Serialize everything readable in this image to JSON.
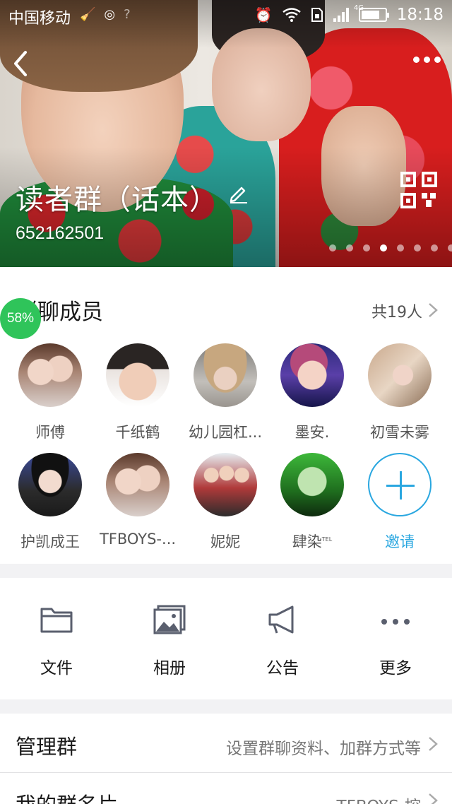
{
  "status_bar": {
    "carrier": "中国移动",
    "network": "4G",
    "time": "18:18",
    "battery_level": 0.8
  },
  "header": {
    "group_name": "读者群（话本）",
    "group_id": "652162501",
    "page_count": 8,
    "active_page": 4
  },
  "members": {
    "title": "群聊成员",
    "count_label": "共19人",
    "progress_badge": "58%",
    "list": [
      {
        "name": "师傅",
        "avatar": "photo-two-girls"
      },
      {
        "name": "千纸鹤",
        "avatar": "photo-boy-cat-ears"
      },
      {
        "name": "幼儿园杠...",
        "avatar": "photo-girl-hat"
      },
      {
        "name": "墨安.",
        "avatar": "photo-boy-stage"
      },
      {
        "name": "初雪未雾",
        "avatar": "photo-girl-street"
      },
      {
        "name": "护凯成王",
        "avatar": "photo-girl-black-cap"
      },
      {
        "name": "TFBOYS-...",
        "avatar": "photo-two-girls"
      },
      {
        "name": "妮妮",
        "avatar": "photo-three-boys"
      },
      {
        "name": "肆染",
        "badge": "TEL",
        "avatar": "photo-girl-green"
      }
    ],
    "invite_label": "邀请"
  },
  "tools": [
    {
      "label": "文件",
      "icon": "folder-icon"
    },
    {
      "label": "相册",
      "icon": "album-icon"
    },
    {
      "label": "公告",
      "icon": "megaphone-icon"
    },
    {
      "label": "更多",
      "icon": "more-dots-icon"
    }
  ],
  "rows": {
    "manage": {
      "title": "管理群",
      "value": "设置群聊资料、加群方式等"
    },
    "card": {
      "title": "我的群名片",
      "value": "TFBOYS-控"
    }
  },
  "colors": {
    "accent": "#2aa7e0",
    "badge_green": "#2fc45a",
    "icon_gray": "#5a5f6e"
  }
}
